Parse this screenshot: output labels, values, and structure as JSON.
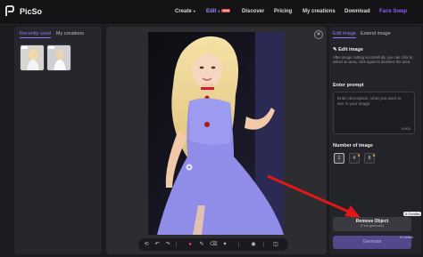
{
  "app": {
    "name": "PicSo"
  },
  "nav": {
    "create": "Create",
    "edit": "Edit",
    "edit_badge": "new",
    "discover": "Discover",
    "pricing": "Pricing",
    "my_creations": "My creations",
    "download": "Download",
    "face_swap": "Face Swap"
  },
  "left_panel": {
    "tabs": [
      "Recently used",
      "My creations"
    ]
  },
  "canvas": {
    "close_icon": "close-icon"
  },
  "right_panel": {
    "tabs": [
      "Edit image",
      "Extend image"
    ],
    "section_title": "Edit image",
    "hint": "After image cutting successfully, you can click to select an area, click again to deselect the area.",
    "prompt_label": "Enter prompt",
    "prompt_placeholder": "Enter description, what you want to see in your image",
    "prompt_counter": "0/500",
    "number_label": "Number of image",
    "numbers": [
      "1",
      "4",
      "8"
    ],
    "remove_label": "Remove Object",
    "remove_sub": "(Fast generate)",
    "remove_credits": "5 Credits",
    "generate_label": "Generate",
    "generate_credits": "5 Credits"
  },
  "colors": {
    "accent": "#8b5cf6",
    "arrow": "#e01818",
    "dress": "#8f8de8"
  }
}
